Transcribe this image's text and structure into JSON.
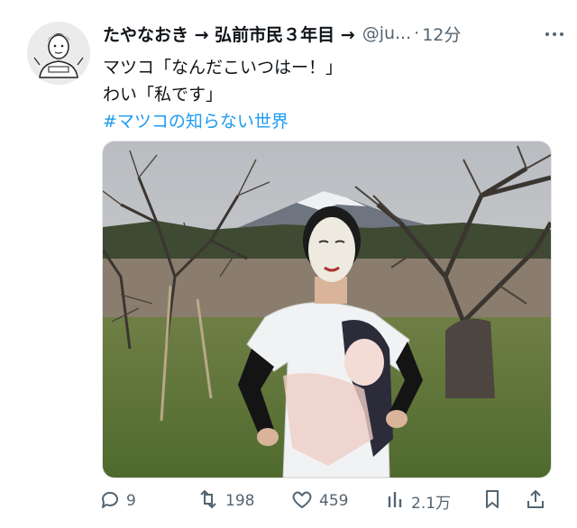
{
  "tweet": {
    "author_name": "たやなおき → 弘前市民３年目 →",
    "handle": "@ju...",
    "dot": "·",
    "time": "12分",
    "line1": "マツコ「なんだこいつはー！」",
    "line2": "わい「私です」",
    "hashtag": "#マツコの知らない世界"
  },
  "actions": {
    "replies": "9",
    "retweets": "198",
    "likes": "459",
    "views": "2.1万"
  },
  "icons": [
    "more-icon",
    "reply-icon",
    "retweet-icon",
    "like-icon",
    "views-icon",
    "bookmark-icon",
    "share-icon"
  ],
  "colors": {
    "text": "#0f1419",
    "muted": "#536471",
    "link": "#1d9bf0"
  }
}
